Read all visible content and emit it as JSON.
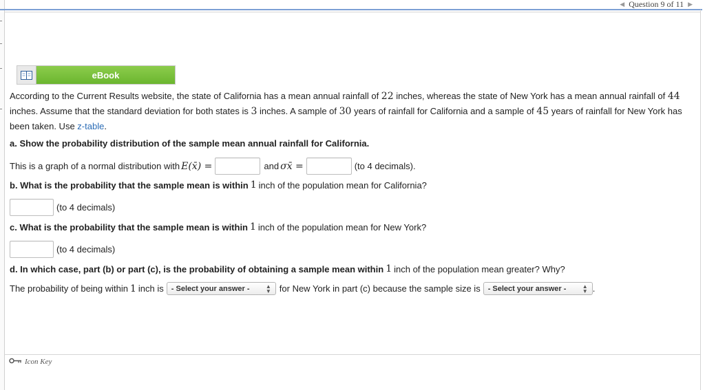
{
  "nav": {
    "question_label": "Question 9 of 11"
  },
  "ebook": {
    "label": "eBook"
  },
  "intro": {
    "t1": "According to the Current Results website, the state of California has a mean annual rainfall of ",
    "ca_mean": "22",
    "t2": " inches, whereas the state of New York has a mean annual rainfall of ",
    "ny_mean": "44",
    "t3": " inches. Assume that the standard deviation for both states is ",
    "sd": "3",
    "t4": " inches. A sample of ",
    "ca_n": "30",
    "t5": " years of rainfall for California and a sample of ",
    "ny_n": "45",
    "t6": " years of rainfall for New York has been taken. Use ",
    "ztable": "z-table",
    "t7": "."
  },
  "part_a": {
    "question": "a. Show the probability distribution of the sample mean annual rainfall for California.",
    "prefix": "This is a graph of a normal distribution with ",
    "expect": "E(x̄) =",
    "and": "and ",
    "sigma": "σx̄ =",
    "suffix": "(to 4 decimals).",
    "input1_value": "",
    "input2_value": ""
  },
  "part_b": {
    "q1": "b. What is the probability that the sample mean is within ",
    "num": "1",
    "q2": " inch of the population mean for California?",
    "suffix": "(to 4 decimals)",
    "input_value": ""
  },
  "part_c": {
    "q1": "c. What is the probability that the sample mean is within ",
    "num": "1",
    "q2": " inch of the population mean for New York?",
    "suffix": "(to 4 decimals)",
    "input_value": ""
  },
  "part_d": {
    "q1": "d. In which case, part (b) or part (c), is the probability of obtaining a sample mean within ",
    "num": "1",
    "q2": " inch of the population mean greater? Why?",
    "s1": "The probability of being within ",
    "snum": "1",
    "s2": " inch is ",
    "s3": " for New York in part (c) because the sample size is ",
    "s4": " .",
    "select1": "- Select your answer -",
    "select2": "- Select your answer -"
  },
  "footer": {
    "icon_key": "Icon Key"
  }
}
